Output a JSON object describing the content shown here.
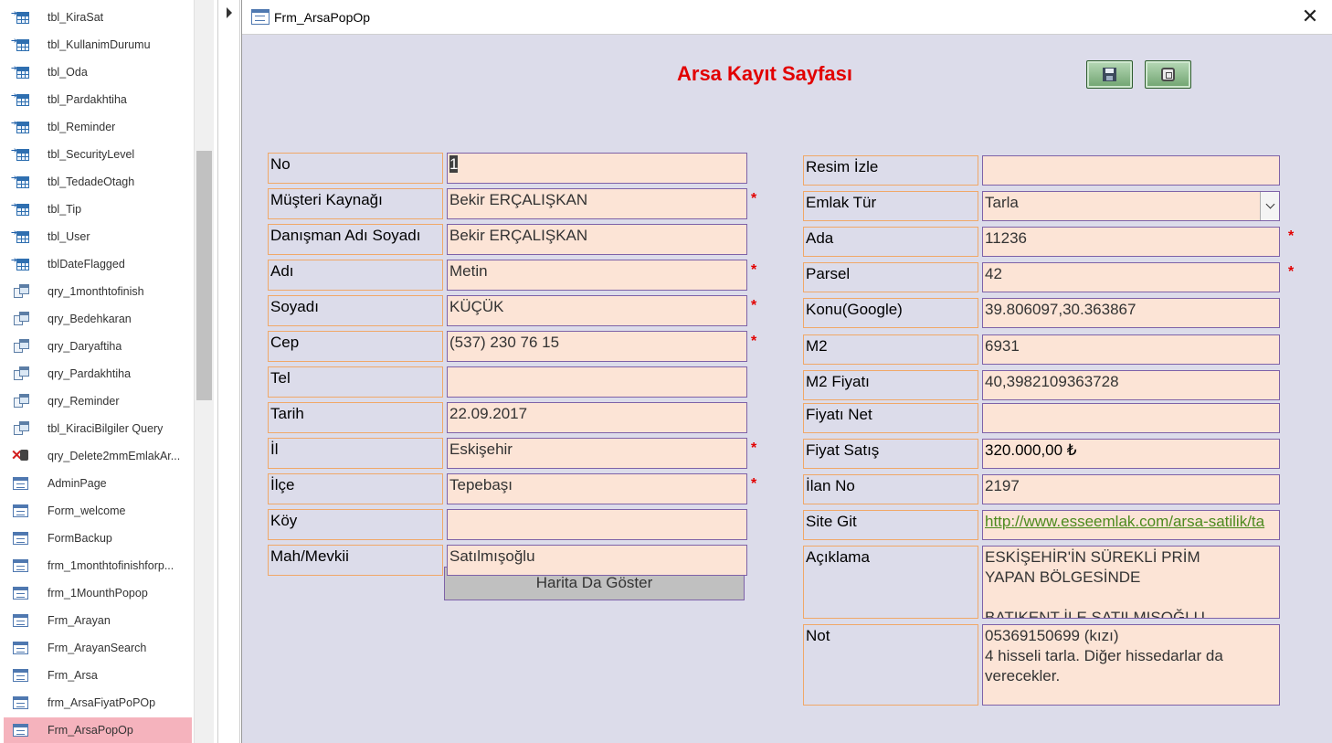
{
  "navigation": {
    "items": [
      {
        "label": "tbl_KiraSat",
        "icon": "table-icon",
        "type": "table"
      },
      {
        "label": "tbl_KullanimDurumu",
        "icon": "table-icon",
        "type": "table"
      },
      {
        "label": "tbl_Oda",
        "icon": "table-icon",
        "type": "table"
      },
      {
        "label": "tbl_Pardakhtiha",
        "icon": "table-icon",
        "type": "table"
      },
      {
        "label": "tbl_Reminder",
        "icon": "table-icon",
        "type": "table"
      },
      {
        "label": "tbl_SecurityLevel",
        "icon": "table-icon",
        "type": "table"
      },
      {
        "label": "tbl_TedadeOtagh",
        "icon": "table-icon",
        "type": "table"
      },
      {
        "label": "tbl_Tip",
        "icon": "table-icon",
        "type": "table"
      },
      {
        "label": "tbl_User",
        "icon": "table-icon",
        "type": "table"
      },
      {
        "label": "tblDateFlagged",
        "icon": "table-icon",
        "type": "table"
      },
      {
        "label": "qry_1monthtofinish",
        "icon": "query-icon",
        "type": "query"
      },
      {
        "label": "qry_Bedehkaran",
        "icon": "query-icon",
        "type": "query"
      },
      {
        "label": "qry_Daryaftiha",
        "icon": "query-icon",
        "type": "query"
      },
      {
        "label": "qry_Pardakhtiha",
        "icon": "query-icon",
        "type": "query"
      },
      {
        "label": "qry_Reminder",
        "icon": "query-icon",
        "type": "query"
      },
      {
        "label": "tbl_KiraciBilgiler Query",
        "icon": "query-icon",
        "type": "query"
      },
      {
        "label": "qry_Delete2mmEmlakAr...",
        "icon": "delete-query-icon",
        "type": "delete"
      },
      {
        "label": "AdminPage",
        "icon": "form-icon",
        "type": "form"
      },
      {
        "label": "Form_welcome",
        "icon": "form-icon",
        "type": "form"
      },
      {
        "label": "FormBackup",
        "icon": "form-icon",
        "type": "form"
      },
      {
        "label": "frm_1monthtofinishforp...",
        "icon": "form-icon",
        "type": "form"
      },
      {
        "label": "frm_1MounthPopop",
        "icon": "form-icon",
        "type": "form"
      },
      {
        "label": "Frm_Arayan",
        "icon": "form-icon",
        "type": "form"
      },
      {
        "label": "Frm_ArayanSearch",
        "icon": "form-icon",
        "type": "form"
      },
      {
        "label": "Frm_Arsa",
        "icon": "form-icon",
        "type": "form"
      },
      {
        "label": "frm_ArsaFiyatPoPOp",
        "icon": "form-icon",
        "type": "form"
      },
      {
        "label": "Frm_ArsaPopOp",
        "icon": "form-icon",
        "type": "form",
        "selected": true
      }
    ]
  },
  "window": {
    "title": "Frm_ArsaPopOp",
    "close_label": "✕"
  },
  "form": {
    "header": "Arsa Kayıt Sayfası",
    "header_color": "#e20000",
    "required_marker": "*",
    "map_button_label": "Harita Da Göster",
    "left_fields": [
      {
        "label": "No",
        "value": "1",
        "required": false,
        "selected": true
      },
      {
        "label": "Müşteri Kaynağı",
        "value": "Bekir ERÇALIŞKAN",
        "required": true
      },
      {
        "label": "Danışman Adı Soyadı",
        "value": "Bekir ERÇALIŞKAN",
        "required": false
      },
      {
        "label": "Adı",
        "value": "Metin",
        "required": true
      },
      {
        "label": "Soyadı",
        "value": "KÜÇÜK",
        "required": true
      },
      {
        "label": "Cep",
        "value": "(537) 230 76 15",
        "required": true
      },
      {
        "label": "Tel",
        "value": "",
        "required": false
      },
      {
        "label": "Tarih",
        "value": "22.09.2017",
        "required": false
      },
      {
        "label": "İl",
        "value": "Eskişehir",
        "required": true
      },
      {
        "label": "İlçe",
        "value": "Tepebaşı",
        "required": true
      },
      {
        "label": "Köy",
        "value": "",
        "required": false
      },
      {
        "label": "Mah/Mevkii",
        "value": "Satılmışoğlu",
        "required": false
      }
    ],
    "right_fields": [
      {
        "label": "Resim İzle",
        "value": ""
      },
      {
        "label": "Emlak Tür",
        "value": "Tarla",
        "combo": true
      },
      {
        "label": "Ada",
        "value": "11236",
        "required": true
      },
      {
        "label": "Parsel",
        "value": "42",
        "required": true
      },
      {
        "label": "Konu(Google)",
        "value": "39.806097,30.363867"
      },
      {
        "label": "M2",
        "value": "6931"
      },
      {
        "label": "M2 Fiyatı",
        "value": "40,3982109363728"
      },
      {
        "label": "Fiyatı Net",
        "value": ""
      },
      {
        "label": "Fiyat Satış",
        "value": "320.000,00 ₺"
      },
      {
        "label": "İlan No",
        "value": "2197"
      },
      {
        "label": "Site Git",
        "value": "http://www.esseemlak.com/arsa-satilik/ta",
        "link": true
      },
      {
        "label": "Açıklama",
        "value": "ESKİŞEHİR'İN SÜREKLİ PRİM\nYAPAN BÖLGESİNDE\n\nBATIKENT İLE SATILMIŞOĞLU",
        "multiline": true
      },
      {
        "label": "Not",
        "value": "05369150699 (kızı)\n4 hisseli tarla. Diğer hissedarlar da\nverecekler.",
        "multiline": true
      }
    ]
  }
}
